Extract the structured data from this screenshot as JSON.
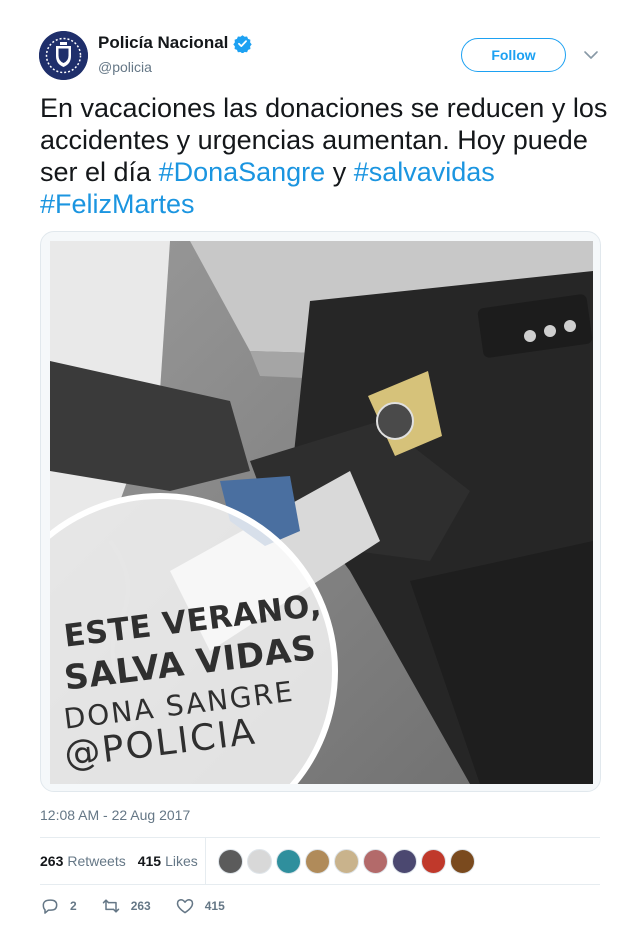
{
  "author": {
    "name": "Policía Nacional",
    "handle": "@policia",
    "follow_label": "Follow"
  },
  "tweet": {
    "text_plain_1": "En vacaciones las donaciones se reducen y los accidentes y urgencias aumentan. Hoy puede ser el día ",
    "hashtag_1": "#DonaSangre",
    "text_plain_2": " y ",
    "hashtag_2": "#salvavidas",
    "text_plain_3": " ",
    "hashtag_3": "#FelizMartes",
    "timestamp": "12:08 AM - 22 Aug 2017"
  },
  "image_overlay": {
    "line1": "ESTE VERANO,",
    "line2": "SALVA VIDAS",
    "line3": "DONA SANGRE",
    "line4": "@POLICIA"
  },
  "stats": {
    "retweets_count": "263",
    "retweets_label": "Retweets",
    "likes_count": "415",
    "likes_label": "Likes"
  },
  "liker_avatar_colors": [
    "#5b5b5b",
    "#d8d8d8",
    "#2f8f9d",
    "#b08b5a",
    "#c9b38c",
    "#b36a6a",
    "#4b4870",
    "#c0392b",
    "#7a4a1e"
  ],
  "actions": {
    "reply_count": "2",
    "retweet_count": "263",
    "like_count": "415"
  },
  "colors": {
    "accent": "#1da1f2",
    "link": "#1b95e0",
    "muted": "#657786",
    "verified": "#1da1f2"
  }
}
